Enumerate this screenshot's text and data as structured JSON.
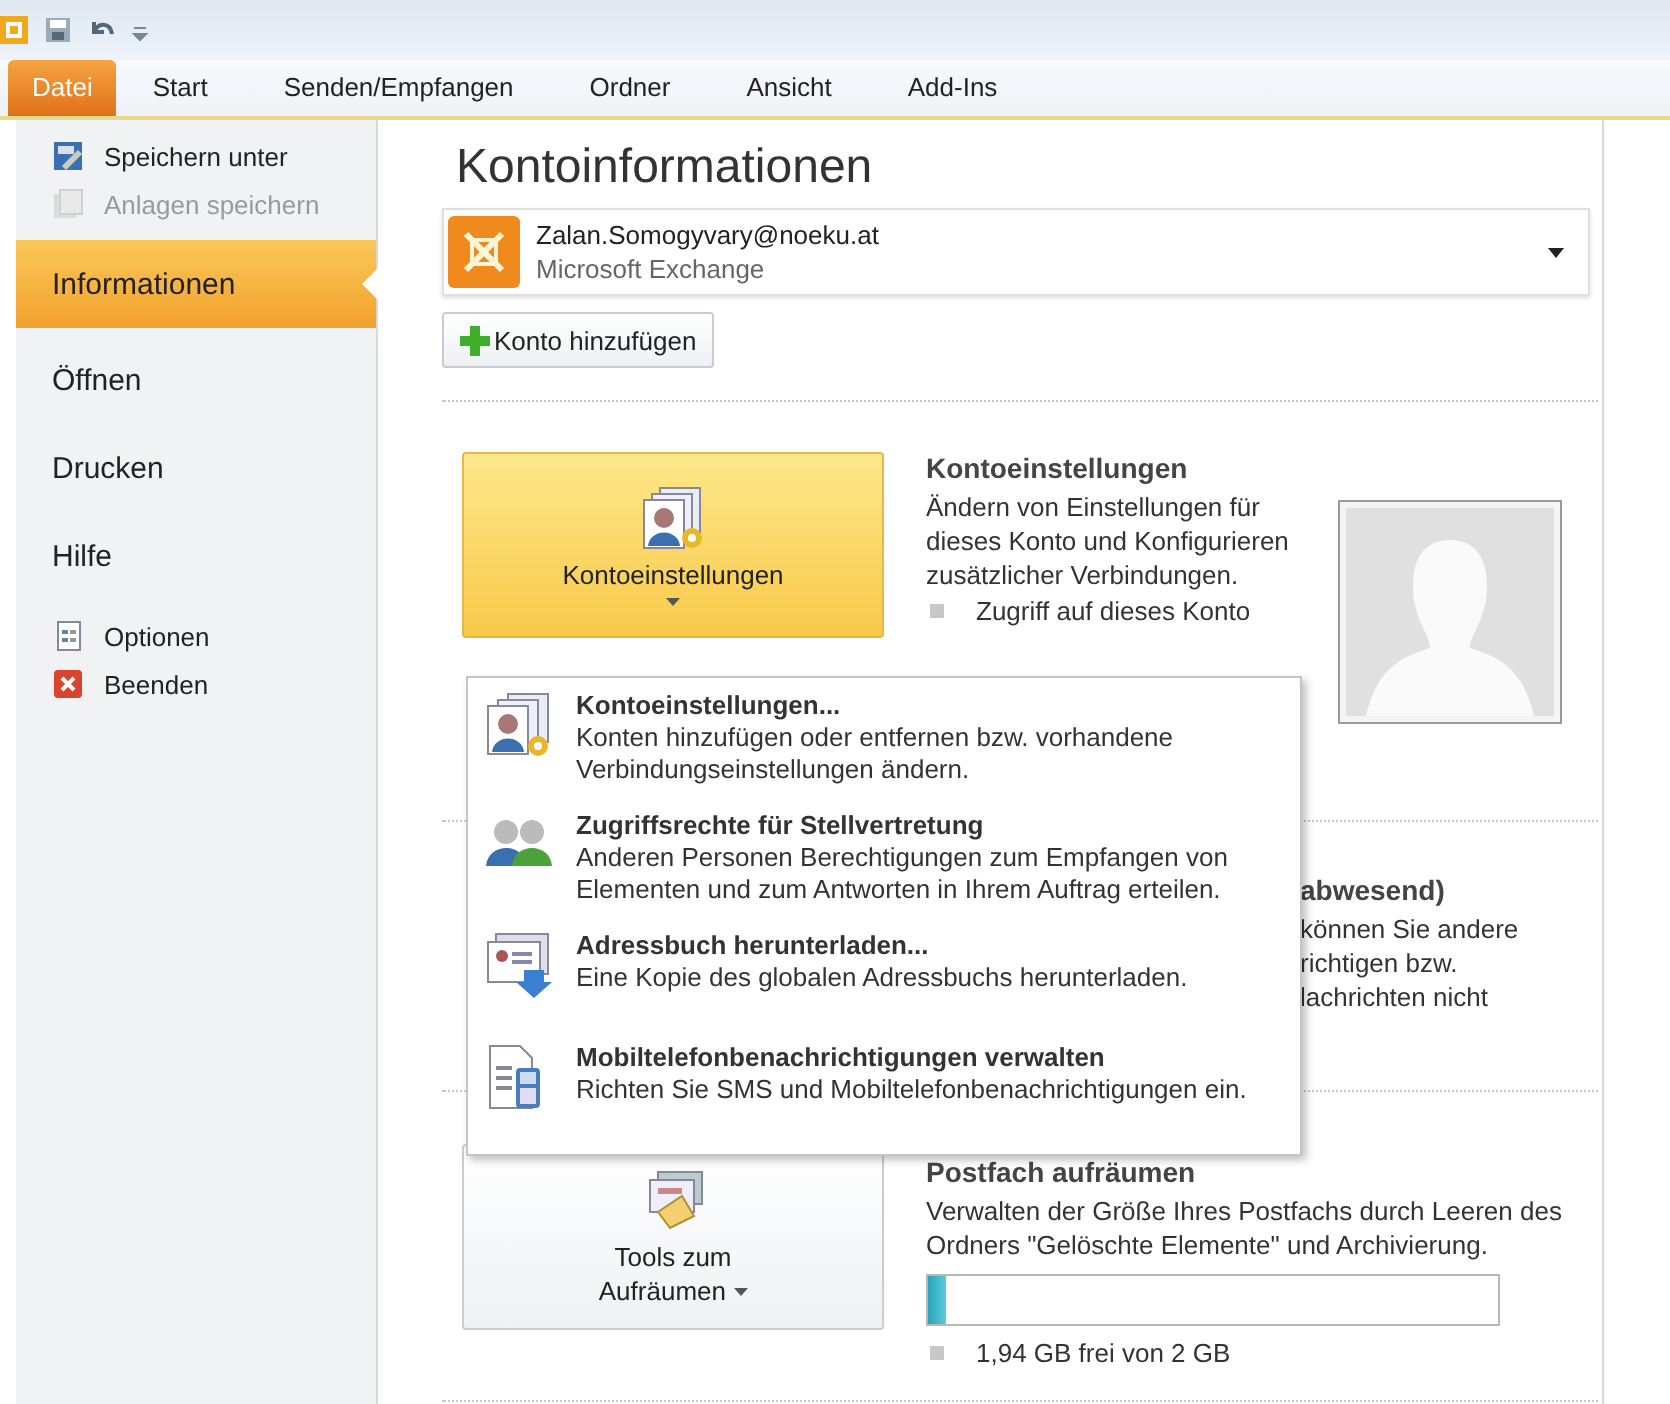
{
  "ribbon_tabs": [
    {
      "label": "Datei",
      "selected": true
    },
    {
      "label": "Start",
      "selected": false
    },
    {
      "label": "Senden/Empfangen",
      "selected": false
    },
    {
      "label": "Ordner",
      "selected": false
    },
    {
      "label": "Ansicht",
      "selected": false
    },
    {
      "label": "Add-Ins",
      "selected": false
    }
  ],
  "sidebar": {
    "items": [
      {
        "kind": "command",
        "label": "Speichern unter",
        "disabled": false
      },
      {
        "kind": "command",
        "label": "Anlagen speichern",
        "disabled": true
      },
      {
        "kind": "tab",
        "label": "Informationen",
        "selected": true
      },
      {
        "kind": "tab",
        "label": "Öffnen",
        "selected": false
      },
      {
        "kind": "tab",
        "label": "Drucken",
        "selected": false
      },
      {
        "kind": "tab",
        "label": "Hilfe",
        "selected": false
      },
      {
        "kind": "command",
        "label": "Optionen",
        "disabled": false
      },
      {
        "kind": "command",
        "label": "Beenden",
        "disabled": false
      }
    ]
  },
  "main": {
    "title": "Kontoinformationen",
    "account": {
      "address": "Zalan.Somogyvary@noeku.at",
      "type": "Microsoft Exchange"
    },
    "add_account_button": "Konto hinzufügen",
    "sections": [
      {
        "kind": "settings",
        "button": "Kontoeinstellungen",
        "heading": "Kontoeinstellungen",
        "description": "Ändern von Einstellungen für dieses Konto und Konfigurieren zusätzlicher Verbindungen.",
        "bullets": [
          "Zugriff auf dieses Konto"
        ]
      },
      {
        "kind": "covered",
        "heading": "abwesend)",
        "lines": [
          "können Sie andere",
          "richtigen bzw.",
          "lachrichten nicht"
        ]
      },
      {
        "kind": "cleanup",
        "button": "Tools zum Aufräumen",
        "heading": "Postfach aufräumen",
        "description": "Verwalten der Größe Ihres Postfachs durch Leeren des Ordners \"Gelöschte Elemente\" und Archivierung.",
        "level": 0.03,
        "reading": "1,94 GB frei von 2 GB"
      }
    ]
  },
  "menu": {
    "items": [
      {
        "title": "Kontoeinstellungen...",
        "description": "Konten hinzufügen oder entfernen bzw. vorhandene Verbindungseinstellungen ändern."
      },
      {
        "title": "Zugriffsrechte für Stellvertretung",
        "description": "Anderen Personen Berechtigungen zum Empfangen von Elementen und zum Antworten in Ihrem Auftrag erteilen."
      },
      {
        "title": "Adressbuch herunterladen...",
        "description": "Eine Kopie des globalen Adressbuchs herunterladen."
      },
      {
        "title": "Mobiltelefonbenachrichtigungen verwalten",
        "description": "Richten Sie SMS und Mobiltelefonbenachrichtigungen ein."
      }
    ]
  }
}
